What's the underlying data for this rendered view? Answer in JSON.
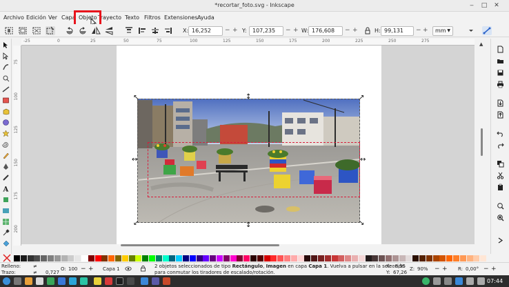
{
  "window": {
    "title": "*recortar_foto.svg - Inkscape",
    "minimize": "‒",
    "maximize": "□",
    "close": "✕"
  },
  "menu": {
    "items": [
      "Archivo",
      "Edición",
      "Ver",
      "Capa",
      "Objeto",
      "Trayecto",
      "Texto",
      "Filtros",
      "Extensiones",
      "Ayuda"
    ],
    "highlighted": "Objeto"
  },
  "toolbar": {
    "x_label": "X:",
    "x_value": "16,252",
    "y_label": "Y:",
    "y_value": "107,235",
    "w_label": "W:",
    "w_value": "176,608",
    "h_label": "H:",
    "h_value": "99,131",
    "unit": "mm",
    "minus": "−",
    "plus": "+"
  },
  "rulers": {
    "top": [
      "-25",
      "0",
      "25",
      "50",
      "75",
      "100",
      "125",
      "150",
      "175",
      "200",
      "225",
      "250",
      "275"
    ],
    "left": [
      "75",
      "100",
      "125",
      "150",
      "175",
      "200"
    ]
  },
  "status": {
    "fill_label": "Relleno:",
    "fill_value": "≠",
    "stroke_label": "Trazo:",
    "stroke_value": "≠",
    "stroke_width": "0,727",
    "opacity_label": "O:",
    "opacity_value": "100",
    "layer": "Capa 1",
    "message_line1_pre": "2 objetos seleccionados de tipo ",
    "message_type1": "Rectángulo",
    "message_sep": ", ",
    "message_type2": "Imagen",
    "message_mid": " en capa ",
    "message_layer": "Capa 1",
    "message_line1_post": ". Vuelva a pulsar en la selección",
    "message_line2": "para conmutar los tiradores de escalado/rotación.",
    "x_label": "X:",
    "x_value": "-8,95",
    "y_label": "Y:",
    "y_value": "67,26",
    "zoom_label": "Z:",
    "zoom_value": "90%",
    "rot_label": "R:",
    "rot_value": "0,00°"
  },
  "taskbar": {
    "clock": "07:44"
  },
  "colors": {
    "highlight": "#e8141c",
    "crop": "#d81b3a"
  },
  "palette": [
    "#000000",
    "#1a1a1a",
    "#333333",
    "#4d4d4d",
    "#666666",
    "#808080",
    "#999999",
    "#b3b3b3",
    "#cccccc",
    "#e6e6e6",
    "#ffffff",
    "#800000",
    "#ff0000",
    "#803300",
    "#ff6600",
    "#806600",
    "#ffcc00",
    "#668000",
    "#ccff00",
    "#008000",
    "#00ff00",
    "#008066",
    "#00ffcc",
    "#006680",
    "#00ccff",
    "#000080",
    "#0000ff",
    "#330080",
    "#6600ff",
    "#660080",
    "#cc00ff",
    "#800066",
    "#ff00cc",
    "#800033",
    "#ff0066",
    "#2b0000",
    "#550000",
    "#d40000",
    "#ff2a2a",
    "#ff5555",
    "#ff8080",
    "#ffaaaa",
    "#ffd5d5",
    "#280b0b",
    "#501616",
    "#782121",
    "#a02c2c",
    "#c83737",
    "#d35f5f",
    "#de8787",
    "#e9afaf",
    "#f4d7d7",
    "#241c1c",
    "#483737",
    "#6c5353",
    "#916f6f",
    "#ac9393",
    "#c8b7b7",
    "#e3dbdb",
    "#2b1100",
    "#552200",
    "#803300",
    "#aa4400",
    "#d45500",
    "#ff6600",
    "#ff7f2a",
    "#ff9955",
    "#ffb380",
    "#ffccaa",
    "#ffe6d5"
  ]
}
